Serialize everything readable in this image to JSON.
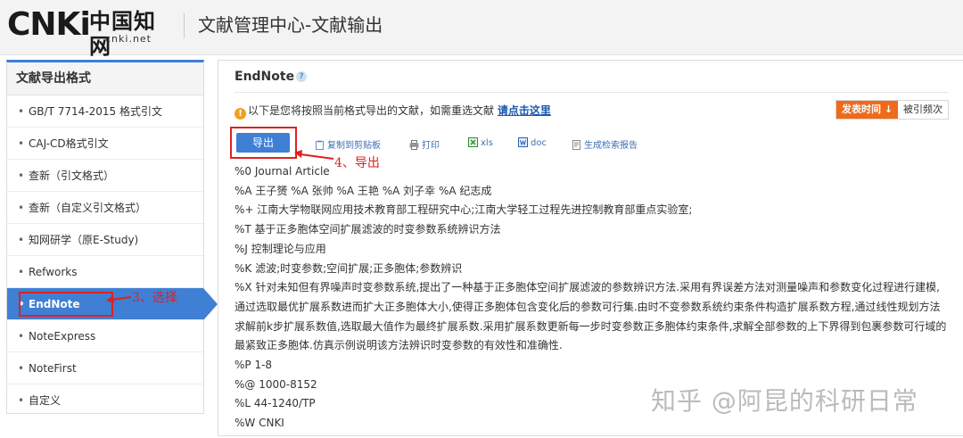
{
  "header": {
    "logo_main": "CNKi",
    "logo_cn": "中国知网",
    "logo_sub": "cnki.net",
    "title": "文献管理中心-文献输出"
  },
  "sidebar": {
    "heading": "文献导出格式",
    "items": [
      {
        "label": "GB/T 7714-2015 格式引文",
        "active": false
      },
      {
        "label": "CAJ-CD格式引文",
        "active": false
      },
      {
        "label": "查新（引文格式）",
        "active": false
      },
      {
        "label": "查新（自定义引文格式）",
        "active": false
      },
      {
        "label": "知网研学（原E-Study)",
        "active": false
      },
      {
        "label": "Refworks",
        "active": false
      },
      {
        "label": "EndNote",
        "active": true
      },
      {
        "label": "NoteExpress",
        "active": false
      },
      {
        "label": "NoteFirst",
        "active": false
      },
      {
        "label": "自定义",
        "active": false
      }
    ]
  },
  "annotations": {
    "step3": "3、选择",
    "step4": "4、导出"
  },
  "main": {
    "title": "EndNote",
    "notice_text": "以下是您将按照当前格式导出的文献，如需重选文献",
    "notice_link": "请点击这里",
    "sort": {
      "time": "发表时间",
      "cited": "被引频次"
    },
    "toolbar": {
      "export": "导出",
      "copy": "复制到剪贴板",
      "print": "打印",
      "xls": "xls",
      "doc": "doc",
      "report": "生成检索报告"
    },
    "record": [
      "%0 Journal Article",
      "%A 王子赟 %A 张帅 %A 王艳 %A 刘子幸 %A 纪志成",
      "%+ 江南大学物联网应用技术教育部工程研究中心;江南大学轻工过程先进控制教育部重点实验室;",
      "%T 基于正多胞体空间扩展滤波的时变参数系统辨识方法",
      "%J 控制理论与应用",
      "%K 滤波;时变参数;空间扩展;正多胞体;参数辨识",
      "%X 针对未知但有界噪声时变参数系统,提出了一种基于正多胞体空间扩展滤波的参数辨识方法.采用有界误差方法对测量噪声和参数变化过程进行建模,通过选取最优扩展系数进而扩大正多胞体大小,使得正多胞体包含变化后的参数可行集.由时不变参数系统约束条件构造扩展系数方程,通过线性规划方法求解前k步扩展系数值,选取最大值作为最终扩展系数.采用扩展系数更新每一步时变参数正多胞体约束条件,求解全部参数的上下界得到包裹参数可行域的最紧致正多胞体.仿真示例说明该方法辨识时变参数的有效性和准确性.",
      "%P 1-8",
      "%@ 1000-8152",
      "%L 44-1240/TP",
      "%W CNKI"
    ]
  },
  "watermark": "知乎 @阿昆的科研日常",
  "colors": {
    "accent": "#3f7fd4",
    "annotation": "#e02020",
    "sort_active": "#f06a1a",
    "link": "#1a57b0"
  }
}
